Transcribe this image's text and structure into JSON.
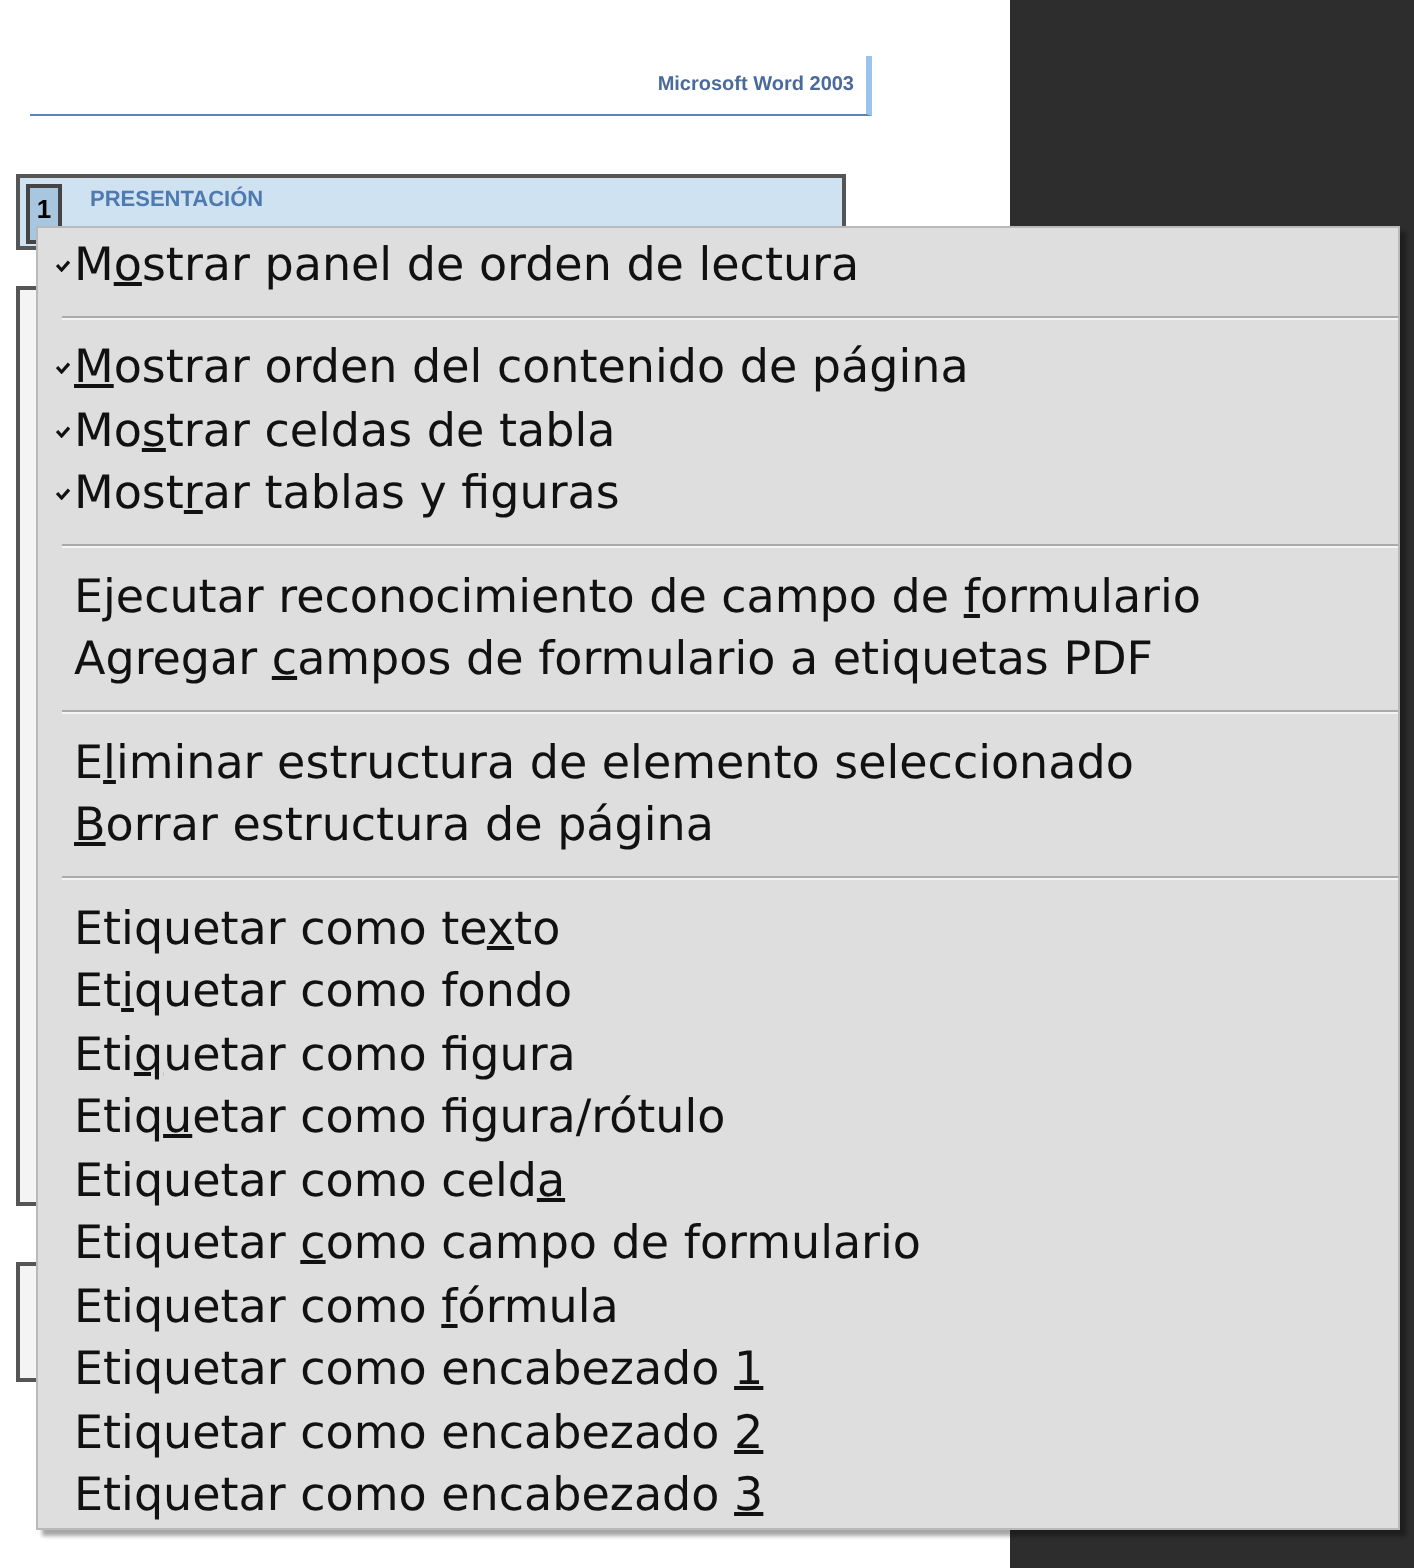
{
  "document": {
    "header": "Microsoft Word 2003",
    "section": {
      "number": "1",
      "title": "PRESENTACIÓN"
    }
  },
  "context_menu": {
    "groups": [
      [
        {
          "pre": "M",
          "key": "o",
          "post": "strar panel de orden de lectura",
          "checked": true
        }
      ],
      [
        {
          "key": "M",
          "post": "ostrar orden del contenido de página",
          "checked": true
        },
        {
          "pre": "Mo",
          "key": "s",
          "post": "trar celdas de tabla",
          "checked": true
        },
        {
          "pre": "Most",
          "key": "r",
          "post": "ar tablas y figuras",
          "checked": true
        }
      ],
      [
        {
          "pre": "Ejecutar reconocimiento de campo de ",
          "key": "f",
          "post": "ormulario",
          "checked": false
        },
        {
          "pre": "Agregar ",
          "key": "c",
          "post": "ampos de formulario a etiquetas PDF",
          "checked": false
        }
      ],
      [
        {
          "pre": "E",
          "key": "l",
          "post": "iminar estructura de elemento seleccionado",
          "checked": false
        },
        {
          "key": "B",
          "post": "orrar estructura de página",
          "checked": false
        }
      ],
      [
        {
          "pre": "Etiquetar como te",
          "key": "x",
          "post": "to",
          "checked": false
        },
        {
          "pre": "Et",
          "key": "i",
          "post": "quetar como fondo",
          "checked": false
        },
        {
          "pre": "Eti",
          "key": "q",
          "post": "uetar como figura",
          "checked": false
        },
        {
          "pre": "Etiq",
          "key": "u",
          "post": "etar como figura/rótulo",
          "checked": false
        },
        {
          "pre": "Etiquetar como celd",
          "key": "a",
          "checked": false
        },
        {
          "pre": "Etiquetar ",
          "key": "c",
          "post": "omo campo de formulario",
          "checked": false
        },
        {
          "pre": "Etiquetar como ",
          "key": "f",
          "post": "órmula",
          "checked": false
        },
        {
          "pre": "Etiquetar como encabezado ",
          "key": "1",
          "checked": false
        },
        {
          "pre": "Etiquetar como encabezado ",
          "key": "2",
          "checked": false
        },
        {
          "pre": "Etiquetar como encabezado ",
          "key": "3",
          "checked": false
        }
      ]
    ]
  }
}
